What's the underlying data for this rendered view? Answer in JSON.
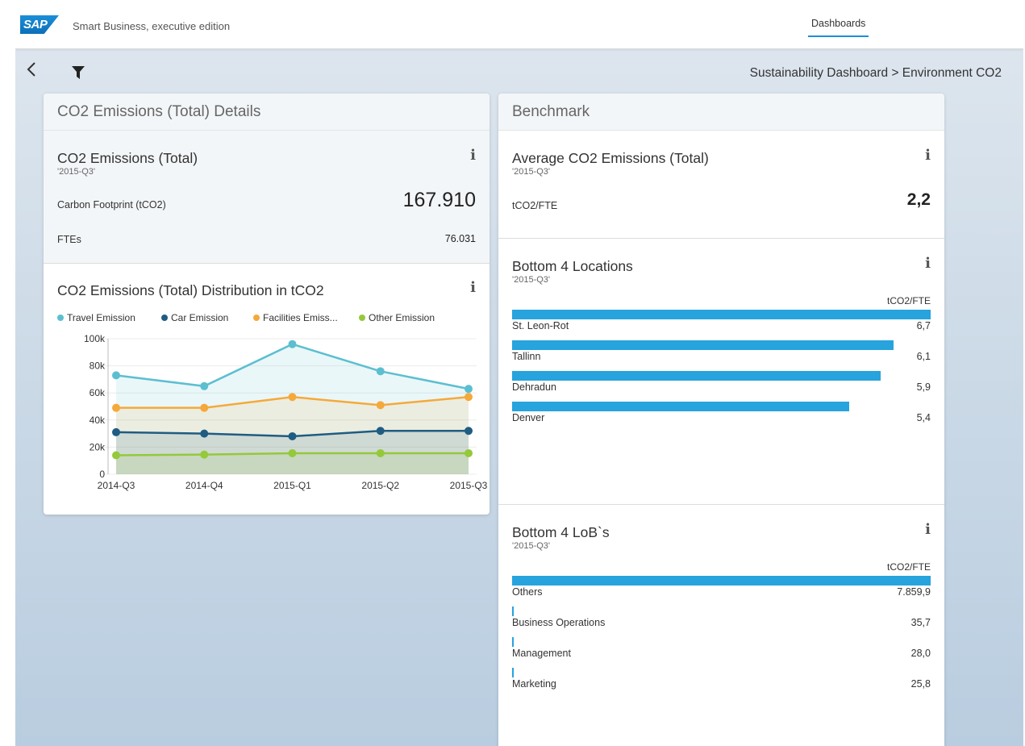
{
  "shell": {
    "logo": "SAP",
    "app_title": "Smart Business, executive edition",
    "nav_tab": "Dashboards"
  },
  "toolbar": {
    "breadcrumb": "Sustainability Dashboard > Environment CO2"
  },
  "left_card": {
    "header": "CO2 Emissions (Total) Details",
    "kpi_tile": {
      "title": "CO2 Emissions (Total)",
      "period": "'2015-Q3'",
      "rows": [
        {
          "label": "Carbon Footprint (tCO2)",
          "value": "167.910"
        },
        {
          "label": "FTEs",
          "value": "76.031"
        }
      ]
    },
    "chart_tile": {
      "title": "CO2 Emissions (Total) Distribution in tCO2"
    }
  },
  "right_card": {
    "header": "Benchmark",
    "avg_tile": {
      "title": "Average CO2 Emissions (Total)",
      "period": "'2015-Q3'",
      "label": "tCO2/FTE",
      "value": "2,2"
    },
    "locations_tile": {
      "title": "Bottom 4 Locations",
      "period": "'2015-Q3'",
      "unit": "tCO2/FTE",
      "items": [
        {
          "label": "St. Leon-Rot",
          "value": "6,7",
          "num": 6.7
        },
        {
          "label": "Tallinn",
          "value": "6,1",
          "num": 6.1
        },
        {
          "label": "Dehradun",
          "value": "5,9",
          "num": 5.9
        },
        {
          "label": "Denver",
          "value": "5,4",
          "num": 5.4
        }
      ]
    },
    "lobs_tile": {
      "title": "Bottom 4 LoB`s",
      "period": "'2015-Q3'",
      "unit": "tCO2/FTE",
      "items": [
        {
          "label": "Others",
          "value": "7.859,9",
          "num": 7859.9
        },
        {
          "label": "Business Operations",
          "value": "35,7",
          "num": 35.7
        },
        {
          "label": "Management",
          "value": "28,0",
          "num": 28.0
        },
        {
          "label": "Marketing",
          "value": "25,8",
          "num": 25.8
        }
      ]
    }
  },
  "icons": {
    "info": "i",
    "back": "<"
  },
  "colors": {
    "accent": "#1b8fd8",
    "bar": "#27a3dd",
    "travel": "#5cbfd0",
    "car": "#1f5c82",
    "facilities": "#f5a93a",
    "other": "#94c93a"
  },
  "chart_data": {
    "type": "area",
    "categories": [
      "2014-Q3",
      "2014-Q4",
      "2015-Q1",
      "2015-Q2",
      "2015-Q3"
    ],
    "series": [
      {
        "name": "Travel Emission",
        "legend": "Travel Emission",
        "values": [
          73000,
          65000,
          96000,
          76000,
          63000
        ],
        "color": "#5cbfd0"
      },
      {
        "name": "Car Emission",
        "legend": "Car Emission",
        "values": [
          31000,
          30000,
          28000,
          32000,
          32000
        ],
        "color": "#1f5c82"
      },
      {
        "name": "Facilities Emission",
        "legend": "Facilities Emiss...",
        "values": [
          49000,
          49000,
          57000,
          51000,
          57000
        ],
        "color": "#f5a93a"
      },
      {
        "name": "Other Emission",
        "legend": "Other Emission",
        "values": [
          14000,
          14500,
          15500,
          15500,
          15500
        ],
        "color": "#94c93a"
      }
    ],
    "yticks": [
      "100k",
      "80k",
      "60k",
      "40k",
      "20k",
      "0"
    ],
    "ylim": [
      0,
      100000
    ],
    "grid": true,
    "legend_position": "top"
  }
}
